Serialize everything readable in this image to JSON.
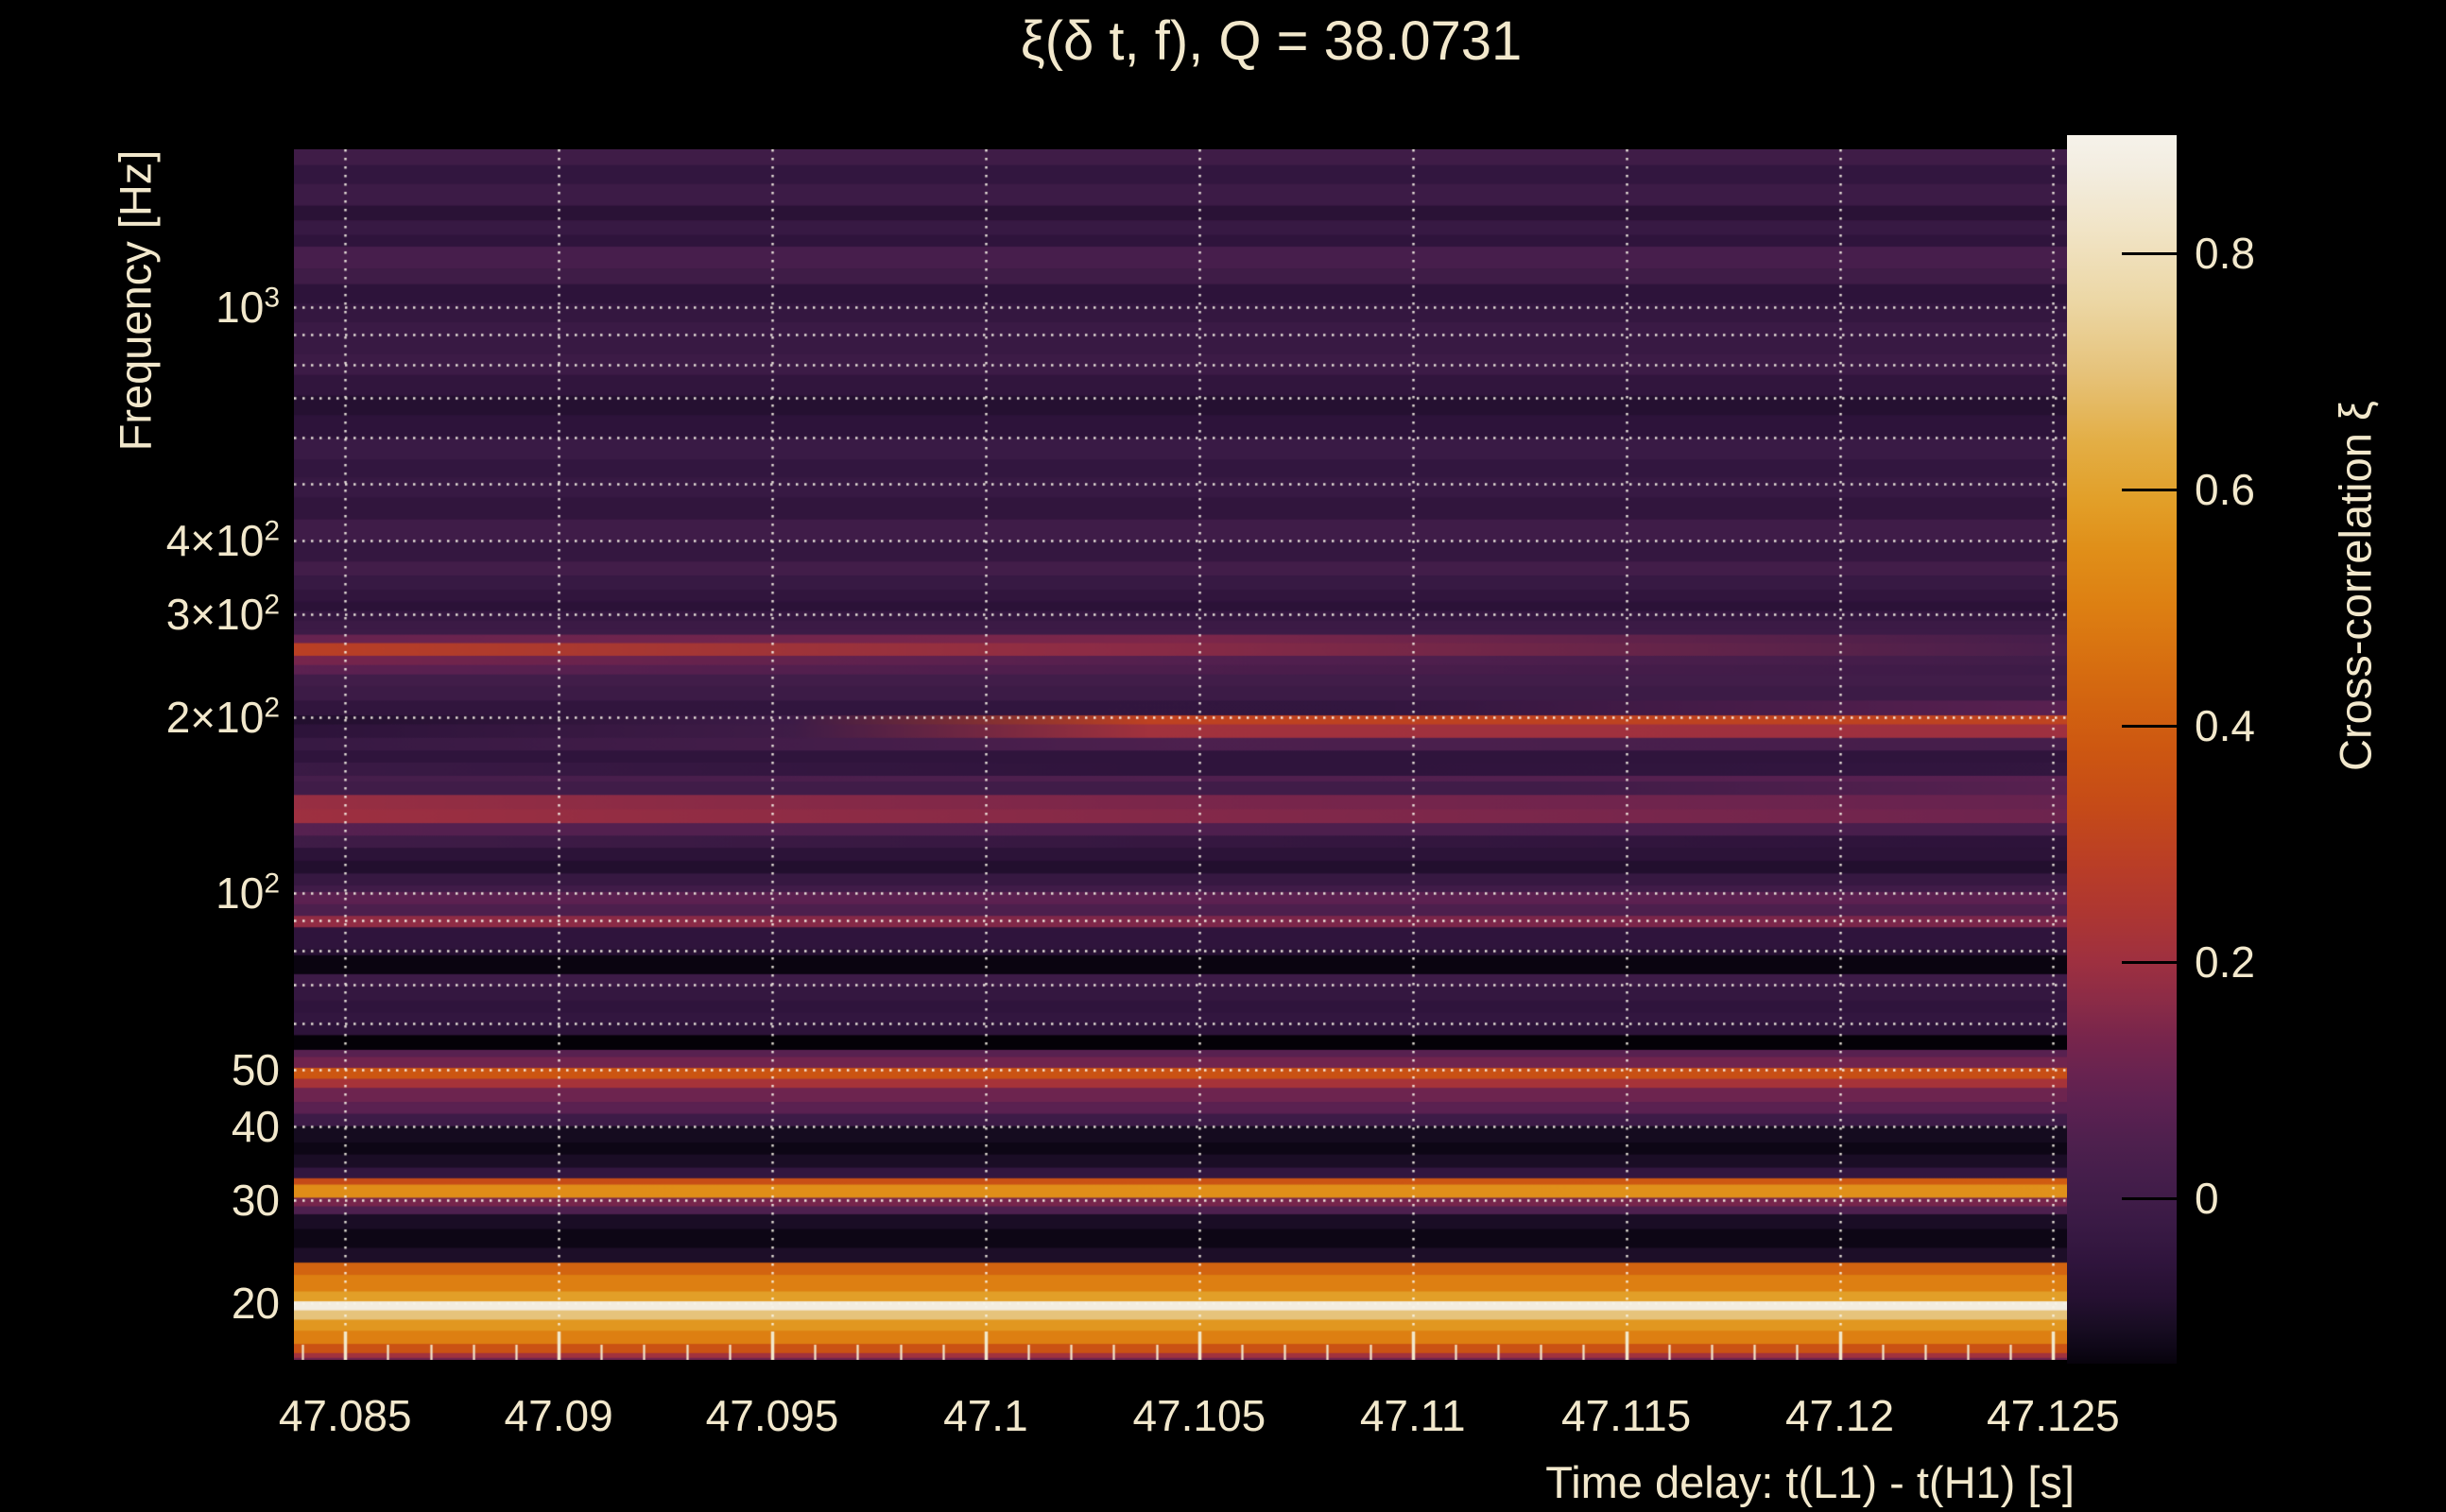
{
  "text_color": "#f2e8cc",
  "background_color": "#000000",
  "chart_data": {
    "type": "heatmap",
    "title": "ξ(δ t, f), Q = 38.0731",
    "xlabel": "Time delay: t(L1) - t(H1) [s]",
    "ylabel": "Frequency [Hz]",
    "x_range": [
      47.0838,
      47.1255
    ],
    "x_ticks": [
      47.085,
      47.09,
      47.095,
      47.1,
      47.105,
      47.11,
      47.115,
      47.12,
      47.125
    ],
    "x_tick_labels": [
      "47.085",
      "47.09",
      "47.095",
      "47.1",
      "47.105",
      "47.11",
      "47.115",
      "47.12",
      "47.125"
    ],
    "x_minor_step": 0.001,
    "y_scale": "log",
    "y_range": [
      16.0,
      1862
    ],
    "y_tick_defs": [
      {
        "v": 1000,
        "t": "10",
        "s": "3"
      },
      {
        "v": 400,
        "t": "4×10",
        "s": "2"
      },
      {
        "v": 300,
        "t": "3×10",
        "s": "2"
      },
      {
        "v": 200,
        "t": "2×10",
        "s": "2"
      },
      {
        "v": 100,
        "t": "10",
        "s": "2"
      },
      {
        "v": 50,
        "t": "50"
      },
      {
        "v": 40,
        "t": "40"
      },
      {
        "v": 30,
        "t": "30"
      },
      {
        "v": 20,
        "t": "20"
      }
    ],
    "grid_y_values": [
      20,
      30,
      40,
      50,
      60,
      70,
      80,
      90,
      100,
      200,
      300,
      400,
      500,
      600,
      700,
      800,
      900,
      1000
    ],
    "grid_color": "rgba(249,244,232,0.92)",
    "colorbar": {
      "label": "Cross-correlation ξ",
      "vmin": -0.14,
      "vmax": 0.9,
      "ticks": [
        {
          "v": 0.8,
          "label": "0.8"
        },
        {
          "v": 0.6,
          "label": "0.6"
        },
        {
          "v": 0.4,
          "label": "0.4"
        },
        {
          "v": 0.2,
          "label": "0.2"
        },
        {
          "v": 0.0,
          "label": "0"
        }
      ]
    },
    "colormap_stops": [
      [
        -0.145,
        "#040107"
      ],
      [
        -0.13,
        "#0d0615"
      ],
      [
        -0.115,
        "#150b1f"
      ],
      [
        -0.1,
        "#1d0e28"
      ],
      [
        -0.085,
        "#251031"
      ],
      [
        -0.07,
        "#2a1236"
      ],
      [
        -0.055,
        "#2f143c"
      ],
      [
        -0.04,
        "#341740"
      ],
      [
        -0.02,
        "#3a1a45"
      ],
      [
        0.0,
        "#401c48"
      ],
      [
        0.02,
        "#451e4b"
      ],
      [
        0.05,
        "#4f204e"
      ],
      [
        0.08,
        "#5c2151"
      ],
      [
        0.105,
        "#682350"
      ],
      [
        0.135,
        "#77254c"
      ],
      [
        0.165,
        "#8a2b47"
      ],
      [
        0.2,
        "#9e3040"
      ],
      [
        0.24,
        "#ad3632"
      ],
      [
        0.28,
        "#b93d27"
      ],
      [
        0.33,
        "#c54a18"
      ],
      [
        0.38,
        "#cd5711"
      ],
      [
        0.44,
        "#d56a10"
      ],
      [
        0.5,
        "#dd7f12"
      ],
      [
        0.55,
        "#e08f19"
      ],
      [
        0.59,
        "#e29f28"
      ],
      [
        0.64,
        "#e3ae45"
      ],
      [
        0.7,
        "#e6c37b"
      ],
      [
        0.76,
        "#ecd7a5"
      ],
      [
        0.82,
        "#f1e4c6"
      ],
      [
        0.87,
        "#f3ede0"
      ],
      [
        0.9,
        "#f6f2ea"
      ]
    ],
    "bands": [
      [
        1746,
        1866,
        -0.005
      ],
      [
        1622,
        1746,
        -0.045
      ],
      [
        1489,
        1622,
        -0.015
      ],
      [
        1406,
        1489,
        -0.07
      ],
      [
        1327,
        1406,
        -0.03
      ],
      [
        1268,
        1327,
        -0.055
      ],
      [
        1164,
        1268,
        0.025
      ],
      [
        1094,
        1164,
        -0.005
      ],
      [
        1014,
        1094,
        -0.06
      ],
      [
        942,
        1014,
        -0.04
      ],
      [
        891,
        942,
        -0.02
      ],
      [
        832,
        891,
        -0.028
      ],
      [
        766,
        832,
        -0.012
      ],
      [
        706,
        766,
        -0.05
      ],
      [
        654,
        706,
        -0.085
      ],
      [
        597,
        654,
        -0.06
      ],
      [
        549,
        597,
        -0.022
      ],
      [
        512,
        549,
        -0.045
      ],
      [
        473,
        512,
        -0.03
      ],
      [
        434,
        473,
        -0.05
      ],
      [
        399,
        434,
        -0.002
      ],
      [
        368,
        399,
        -0.04
      ],
      [
        348,
        368,
        0.008
      ],
      [
        329,
        348,
        -0.03
      ],
      [
        314,
        329,
        -0.05
      ],
      [
        303,
        314,
        -0.068
      ],
      [
        292,
        303,
        -0.038
      ],
      [
        282,
        292,
        -0.018
      ],
      [
        276,
        282,
        -0.015
      ],
      [
        267,
        276,
        [
          [
            0,
            0.1
          ],
          [
            0.5,
            0.145
          ],
          [
            1,
            0.02
          ]
        ]
      ],
      [
        254,
        267,
        [
          [
            0,
            0.29
          ],
          [
            0.45,
            0.17
          ],
          [
            1,
            0.03
          ]
        ]
      ],
      [
        245,
        254,
        [
          [
            0,
            0.135
          ],
          [
            0.5,
            0.06
          ],
          [
            1,
            0.005
          ]
        ]
      ],
      [
        236,
        245,
        [
          [
            0,
            0.08
          ],
          [
            1,
            -0.01
          ]
        ]
      ],
      [
        225,
        236,
        0.005
      ],
      [
        213,
        225,
        -0.015
      ],
      [
        201,
        213,
        [
          [
            0,
            -0.05
          ],
          [
            0.6,
            -0.045
          ],
          [
            1,
            0.075
          ]
        ]
      ],
      [
        194,
        201,
        [
          [
            0,
            -0.09
          ],
          [
            0.28,
            -0.01
          ],
          [
            0.48,
            0.3
          ],
          [
            1,
            0.305
          ]
        ]
      ],
      [
        184,
        194,
        [
          [
            0,
            -0.06
          ],
          [
            0.28,
            -0.005
          ],
          [
            0.48,
            0.21
          ],
          [
            1,
            0.2
          ]
        ]
      ],
      [
        175,
        184,
        [
          [
            0,
            -0.03
          ],
          [
            0.5,
            0.045
          ],
          [
            1,
            0.02
          ]
        ]
      ],
      [
        167,
        175,
        -0.055
      ],
      [
        158.5,
        167,
        [
          [
            0,
            -0.02
          ],
          [
            0.5,
            -0.055
          ],
          [
            1,
            -0.045
          ]
        ]
      ],
      [
        155,
        158.5,
        [
          [
            0,
            0.02
          ],
          [
            1,
            0.075
          ]
        ]
      ],
      [
        147,
        155,
        [
          [
            0,
            0.0
          ],
          [
            0.7,
            0.0
          ],
          [
            1,
            0.07
          ]
        ]
      ],
      [
        139,
        147,
        [
          [
            0,
            0.19
          ],
          [
            0.5,
            0.14
          ],
          [
            1,
            0.1
          ]
        ]
      ],
      [
        131.6,
        139,
        [
          [
            0,
            0.2
          ],
          [
            0.5,
            0.155
          ],
          [
            1,
            0.115
          ]
        ]
      ],
      [
        125.3,
        131.6,
        [
          [
            0,
            0.065
          ],
          [
            1,
            0.025
          ]
        ]
      ],
      [
        119.4,
        125.3,
        [
          [
            0,
            -0.005
          ],
          [
            1,
            -0.06
          ]
        ]
      ],
      [
        113.5,
        119.4,
        -0.065
      ],
      [
        108,
        113.5,
        -0.09
      ],
      [
        103,
        108,
        -0.035
      ],
      [
        100.4,
        103,
        0.0
      ],
      [
        95.7,
        100.4,
        0.08
      ],
      [
        91.4,
        95.7,
        0.04
      ],
      [
        87.4,
        91.4,
        [
          [
            0,
            0.18
          ],
          [
            0.5,
            0.145
          ],
          [
            1,
            0.14
          ]
        ]
      ],
      [
        80.3,
        87.4,
        -0.055
      ],
      [
        78.3,
        80.3,
        -0.075
      ],
      [
        72.7,
        78.3,
        -0.135
      ],
      [
        69.2,
        72.7,
        -0.01
      ],
      [
        65.5,
        69.2,
        -0.04
      ],
      [
        62.6,
        65.5,
        -0.055
      ],
      [
        60,
        62.6,
        -0.045
      ],
      [
        57.2,
        60,
        -0.06
      ],
      [
        54,
        57.2,
        -0.145
      ],
      [
        52.5,
        54,
        0.07
      ],
      [
        50.3,
        52.5,
        0.12
      ],
      [
        48.2,
        50.3,
        [
          [
            0,
            0.38
          ],
          [
            1,
            0.345
          ]
        ]
      ],
      [
        46.5,
        48.2,
        0.22
      ],
      [
        44,
        46.5,
        0.115
      ],
      [
        42,
        44,
        0.075
      ],
      [
        40,
        42,
        -0.01
      ],
      [
        37.5,
        40,
        -0.115
      ],
      [
        35.8,
        37.5,
        -0.13
      ],
      [
        34,
        35.8,
        -0.105
      ],
      [
        32.6,
        34,
        -0.045
      ],
      [
        31.8,
        32.6,
        [
          [
            0,
            0.33
          ],
          [
            1,
            0.4
          ]
        ]
      ],
      [
        30.2,
        31.8,
        [
          [
            0,
            0.545
          ],
          [
            1,
            0.555
          ]
        ]
      ],
      [
        29.2,
        30.2,
        0.135
      ],
      [
        28.3,
        29.2,
        0.045
      ],
      [
        26.7,
        28.3,
        -0.105
      ],
      [
        24.8,
        26.7,
        -0.13
      ],
      [
        23.4,
        24.8,
        -0.1
      ],
      [
        22.3,
        23.4,
        0.42
      ],
      [
        20.9,
        22.3,
        0.5
      ],
      [
        20.1,
        20.9,
        0.59
      ],
      [
        19.4,
        20.1,
        0.87
      ],
      [
        18.7,
        19.4,
        0.7
      ],
      [
        17.9,
        18.7,
        0.57
      ],
      [
        17.0,
        17.9,
        0.5
      ],
      [
        16.4,
        17.0,
        0.36
      ],
      [
        16.1,
        16.4,
        0.21
      ],
      [
        16.0,
        16.1,
        0.12
      ]
    ]
  }
}
